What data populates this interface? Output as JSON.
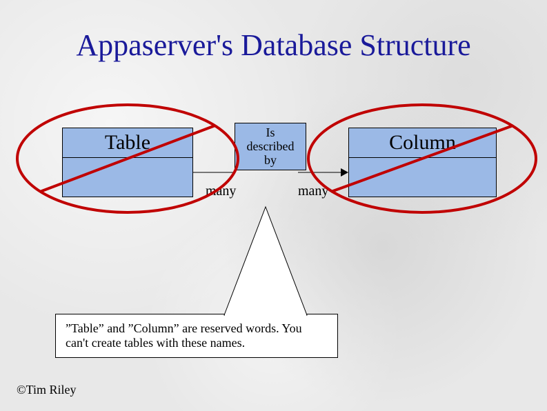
{
  "title": "Appaserver's Database Structure",
  "entities": {
    "left": {
      "name": "Table"
    },
    "right": {
      "name": "Column"
    }
  },
  "relationship": {
    "label": "Is\ndescribed\nby",
    "left_cardinality": "many",
    "right_cardinality": "many"
  },
  "callout": "”Table” and ”Column” are reserved words. You can't create tables with these names.",
  "copyright": "©Tim Riley",
  "colors": {
    "title": "#1a1a9a",
    "box_fill": "#9bb9e6",
    "strike": "#c00000"
  }
}
